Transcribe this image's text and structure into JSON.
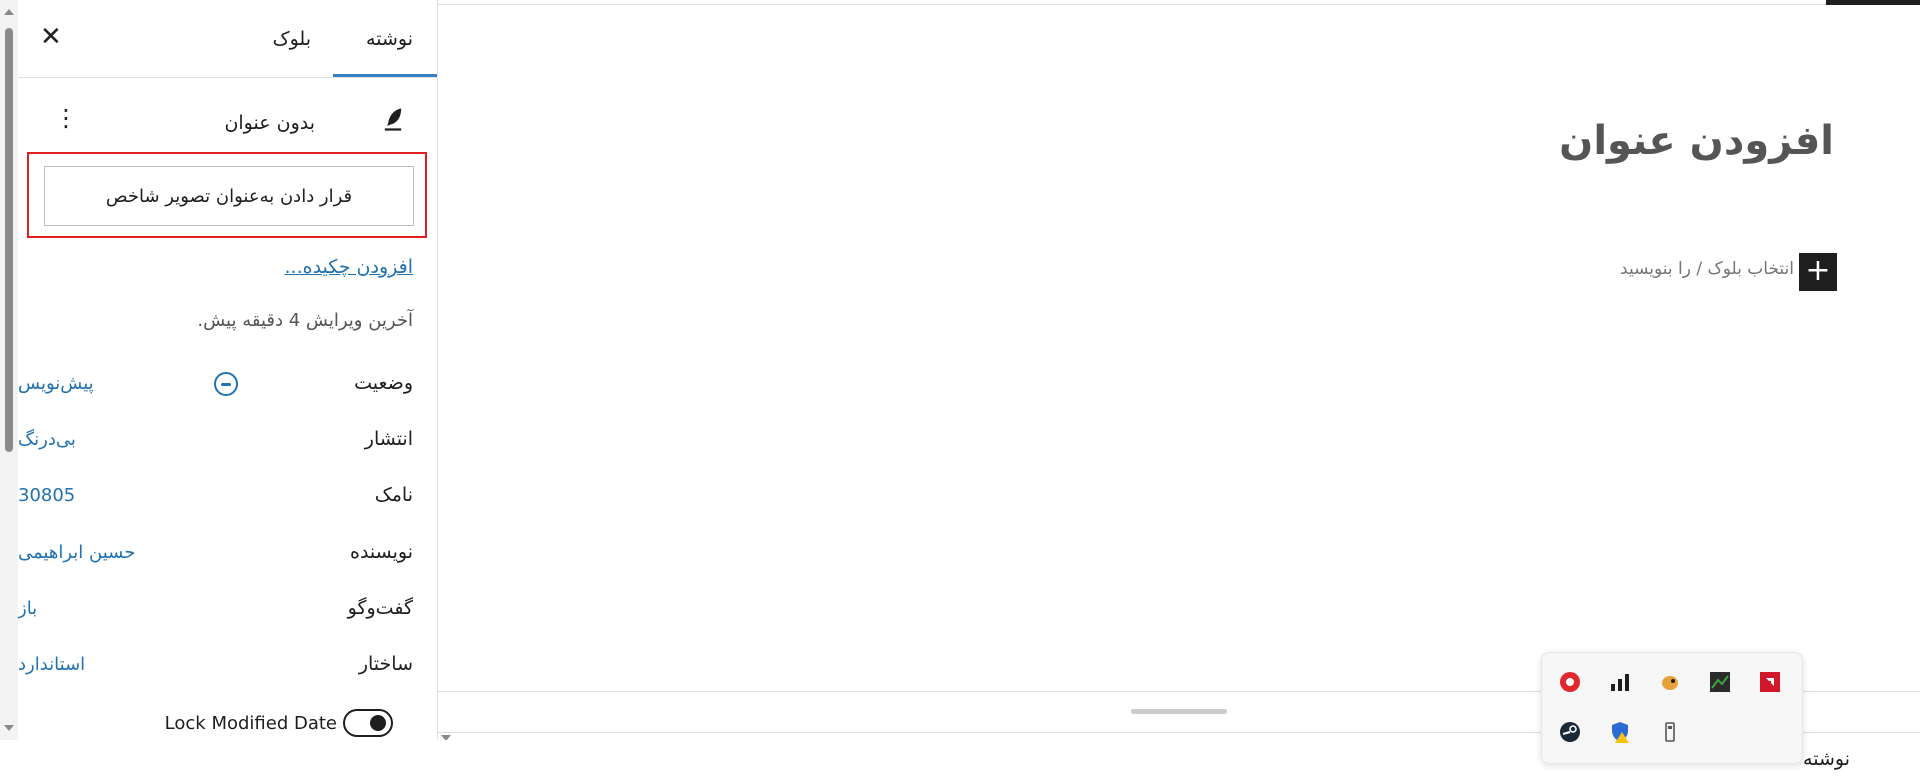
{
  "sidebar": {
    "tabs": [
      {
        "label": "نوشته"
      },
      {
        "label": "بلوک"
      }
    ],
    "post_title": "بدون عنوان",
    "featured_image_button": "قرار دادن به‌عنوان تصویر شاخص",
    "add_excerpt_link": "افزودن چکیده...",
    "last_edited": "آخرین ویرایش 4 دقیقه پیش.",
    "rows": [
      {
        "label": "وضعیت",
        "value": "پیش‌نویس"
      },
      {
        "label": "انتشار",
        "value": "بی‌درنگ"
      },
      {
        "label": "نامک",
        "value": "30805"
      },
      {
        "label": "نویسنده",
        "value": "حسین ابراهیمی"
      },
      {
        "label": "گفت‌وگو",
        "value": "باز"
      },
      {
        "label": "ساختار",
        "value": "استاندارد"
      }
    ],
    "lock_modified_date": {
      "label": "Lock Modified Date",
      "enabled": false
    }
  },
  "editor": {
    "title_placeholder": "افزودن عنوان",
    "block_placeholder": "انتخاب بلوک / را بنویسید",
    "inserter_symbol": "+"
  },
  "footer": {
    "label": "نوشته"
  },
  "tray_icons": [
    {
      "name": "record-icon",
      "color": "#e0282e"
    },
    {
      "name": "network-bars-icon",
      "color": "#1e1e1e"
    },
    {
      "name": "fish-app-icon",
      "color": "#e8a23a"
    },
    {
      "name": "tweak-app-icon",
      "color": "#3ea33e"
    },
    {
      "name": "amd-icon",
      "color": "#d1182a"
    },
    {
      "name": "steam-icon",
      "color": "#1b2838"
    },
    {
      "name": "security-shield-warning-icon",
      "color": "#2a6bd6"
    },
    {
      "name": "usb-drive-icon",
      "color": "#555555"
    }
  ]
}
